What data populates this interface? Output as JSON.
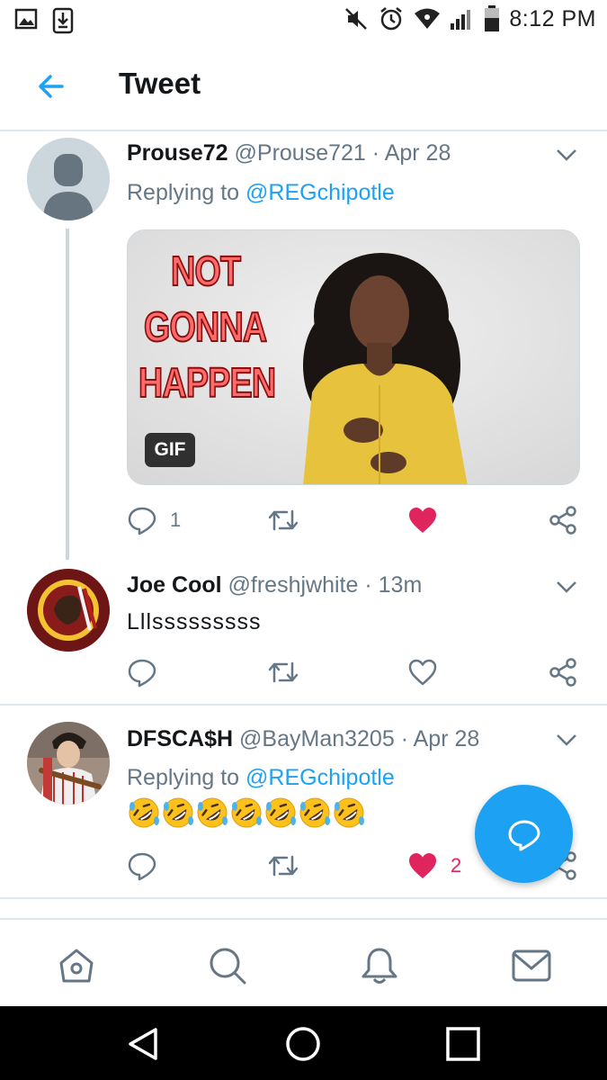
{
  "status_bar": {
    "time": "8:12 PM",
    "icons_left": [
      "image-notification-icon",
      "download-notification-icon"
    ],
    "icons_right": [
      "mute-icon",
      "alarm-icon",
      "wifi-icon",
      "signal-icon",
      "battery-icon"
    ]
  },
  "header": {
    "back_icon": "back-arrow-icon",
    "title": "Tweet"
  },
  "tweets": [
    {
      "display_name": "Prouse72",
      "handle": "@Prouse721",
      "separator": "·",
      "time": "Apr 28",
      "replying_prefix": "Replying to",
      "replying_to": "@REGchipotle",
      "media": {
        "badge": "GIF",
        "text_lines": [
          "NOT",
          "GONNA",
          "HAPPEN"
        ]
      },
      "reply_count": "1",
      "like_count": "",
      "liked": true
    },
    {
      "display_name": "Joe Cool",
      "handle": "@freshjwhite",
      "separator": "·",
      "time": "13m",
      "text": "Lllsssssssss",
      "liked": false
    },
    {
      "display_name": "DFSCA$H",
      "handle": "@BayMan3205",
      "separator": "·",
      "time": "Apr 28",
      "replying_prefix": "Replying to",
      "replying_to": "@REGchipotle",
      "emoji": "rolling-on-the-floor-laughing",
      "emoji_count": 7,
      "like_count": "2",
      "liked": true
    }
  ],
  "fab": {
    "icon": "compose-reply-icon"
  },
  "bottom_nav": [
    "home-icon",
    "search-icon",
    "notifications-icon",
    "messages-icon"
  ],
  "system_nav": [
    "back-icon",
    "home-circle-icon",
    "recents-icon"
  ],
  "colors": {
    "accent": "#1da1f2",
    "like": "#e0245e",
    "secondary_text": "#657786",
    "divider": "#e1e8ed"
  }
}
